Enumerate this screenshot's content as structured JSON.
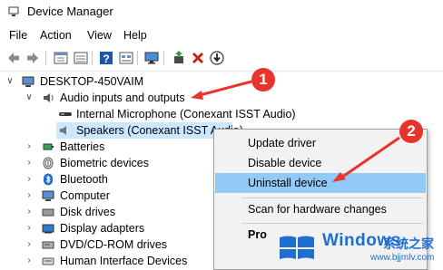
{
  "window": {
    "title": "Device Manager"
  },
  "menu": [
    "File",
    "Action",
    "View",
    "Help"
  ],
  "toolbar": {
    "icons": [
      "back-arrow-icon",
      "forward-arrow-icon",
      "properties-icon",
      "list-view-icon",
      "help-icon",
      "resource-view-icon",
      "monitor-icon",
      "update-driver-icon",
      "uninstall-x-icon",
      "download-icon"
    ]
  },
  "tree": {
    "root": "DESKTOP-450VAIM",
    "audio_group": "Audio inputs and outputs",
    "audio_children": [
      "Internal Microphone (Conexant ISST Audio)",
      "Speakers (Conexant ISST Audio)"
    ],
    "categories": [
      "Batteries",
      "Biometric devices",
      "Bluetooth",
      "Computer",
      "Disk drives",
      "Display adapters",
      "DVD/CD-ROM drives",
      "Human Interface Devices"
    ]
  },
  "context_menu": {
    "items": [
      "Update driver",
      "Disable device",
      "Uninstall device",
      "Scan for hardware changes",
      "Pro"
    ],
    "highlighted_index": 2
  },
  "annotations": {
    "badge_1": "1",
    "badge_2": "2",
    "color": "#e8342b"
  },
  "watermark": {
    "word": "Windows",
    "cn": "系统之家",
    "url": "www.bjjmlv.com"
  }
}
